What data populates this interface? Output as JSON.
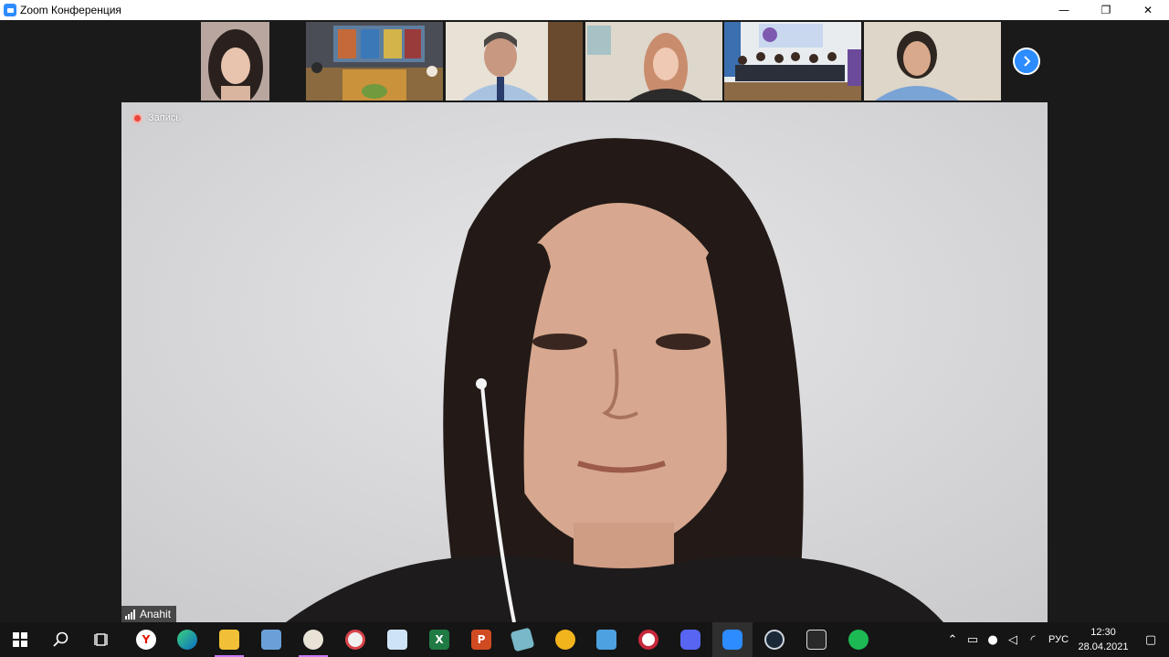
{
  "window": {
    "title": "Zoom Конференция",
    "controls": {
      "minimize": "—",
      "restore": "❐",
      "close": "✕"
    }
  },
  "recording": {
    "label": "Запись",
    "color": "#e8463a"
  },
  "active_speaker": {
    "name": "Anahit"
  },
  "participants_strip": {
    "thumbnails": [
      {
        "id": "girl-portrait"
      },
      {
        "id": "library-room"
      },
      {
        "id": "man-in-shirt"
      },
      {
        "id": "girl-blonde"
      },
      {
        "id": "classroom-group"
      },
      {
        "id": "woman-smiling"
      }
    ],
    "next_button": "next-page-icon"
  },
  "taskbar": {
    "icons": [
      "windows-start-icon",
      "search-icon",
      "task-view-icon",
      "yandex-browser-icon",
      "edge-icon",
      "file-explorer-icon",
      "photos-icon",
      "paint-icon",
      "paint-3d-icon",
      "notepad-icon",
      "excel-icon",
      "powerpoint-icon",
      "stickies-icon",
      "chrome-canary-icon",
      "calculator-icon",
      "opera-icon",
      "discord-icon",
      "zoom-icon",
      "steam-icon",
      "epic-games-icon",
      "spotify-icon"
    ],
    "tray": {
      "language": "РУС",
      "time": "12:30",
      "date": "28.04.2021"
    }
  },
  "colors": {
    "accent": "#2d8cff",
    "taskbar": "#151515",
    "background": "#1a1a1a"
  }
}
